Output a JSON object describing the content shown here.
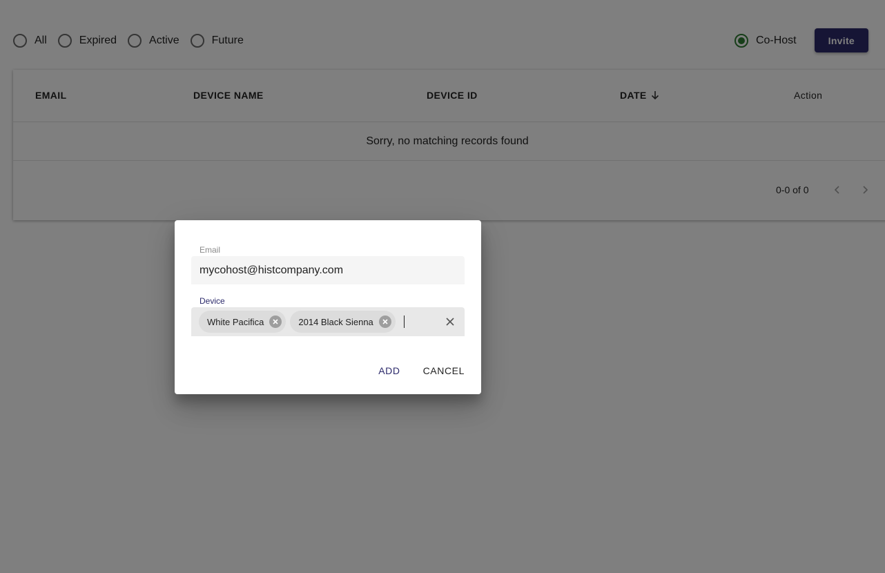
{
  "filters": {
    "options": [
      {
        "label": "All",
        "checked": false
      },
      {
        "label": "Expired",
        "checked": false
      },
      {
        "label": "Active",
        "checked": false
      },
      {
        "label": "Future",
        "checked": false
      }
    ],
    "cohost": {
      "label": "Co-Host",
      "checked": true
    },
    "invite_label": "Invite"
  },
  "table": {
    "columns": [
      "EMAIL",
      "DEVICE NAME",
      "DEVICE ID",
      "DATE",
      "Action"
    ],
    "sort_column": "DATE",
    "sort_icon": "arrow-down-icon",
    "empty_message": "Sorry, no matching records found",
    "pagination": {
      "range": "0-0 of 0"
    }
  },
  "dialog": {
    "email_label": "Email",
    "email_value": "mycohost@histcompany.com",
    "device_label": "Device",
    "devices": [
      "White Pacifica",
      "2014 Black Sienna"
    ],
    "add_label": "ADD",
    "cancel_label": "CANCEL"
  },
  "colors": {
    "accent": "#2c2a6b",
    "radio_checked": "#2e7d32",
    "overlay": "rgba(0,0,0,0.5)"
  }
}
